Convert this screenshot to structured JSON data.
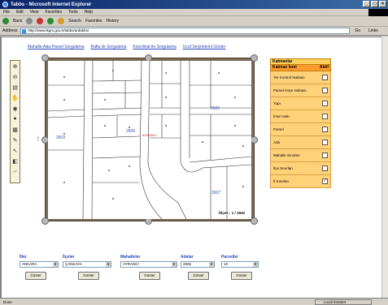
{
  "window": {
    "title": "Tabbs - Microsoft Internet Explorer"
  },
  "menu": [
    "File",
    "Edit",
    "View",
    "Favorites",
    "Tools",
    "Help"
  ],
  "toolbar": {
    "back": "Back",
    "search": "Search",
    "favorites": "Favorites",
    "history": "History"
  },
  "address": {
    "label": "Address",
    "url": "http://www.tkgm.gov.tr/tabbs/ardabbs/",
    "go": "Go",
    "links": "Links"
  },
  "nav_links": [
    "Mahalle-Ada-Parsel Sorgulama",
    "Rafta ile Sorgulama",
    "Koordinat ile Sorgulama",
    "Ucuf Seçimlerini Göster"
  ],
  "tools": [
    "zoom-in",
    "zoom-out",
    "print",
    "pan",
    "refresh",
    "info",
    "grid",
    "measure",
    "select",
    "layers",
    "identify"
  ],
  "map": {
    "scale_text": "Ölçek : 1 / 1940",
    "labels": [
      "2606",
      "2605",
      "2607",
      "2603",
      "AYRANCI"
    ]
  },
  "layer_panel": {
    "title": "Katmanlar",
    "col_name": "Katman İsmi",
    "col_active": "Aktif",
    "layers": [
      {
        "name": "Yer Kontrol Noktası",
        "checked": false
      },
      {
        "name": "Parsel Köşe Noktası",
        "checked": false
      },
      {
        "name": "Yapı",
        "checked": false
      },
      {
        "name": "İmar Hattı",
        "checked": false
      },
      {
        "name": "Parsel",
        "checked": false
      },
      {
        "name": "Ada",
        "checked": false
      },
      {
        "name": "Mahalle Sınırları",
        "checked": false
      },
      {
        "name": "İlçe Sınırları",
        "checked": false
      },
      {
        "name": "İl Sınırları",
        "checked": true
      }
    ]
  },
  "filters": [
    {
      "label": "İller",
      "value": "ANKARA",
      "button": "Göster"
    },
    {
      "label": "İlçeler",
      "value": "ÇANKAYA",
      "button": "Göster"
    },
    {
      "label": "Mahalleler",
      "value": "AYRANCI",
      "button": "Göster"
    },
    {
      "label": "Adalar",
      "value": "2606",
      "button": "Göster"
    },
    {
      "label": "Parseller",
      "value": "10",
      "button": "Göster"
    }
  ],
  "status": {
    "left": "Done",
    "zone": "Local intranet"
  },
  "colors": {
    "link": "#2b45b8",
    "panel_header": "#ff9a30",
    "panel_row": "#ffd27a",
    "map_frame": "#7a6a55"
  }
}
